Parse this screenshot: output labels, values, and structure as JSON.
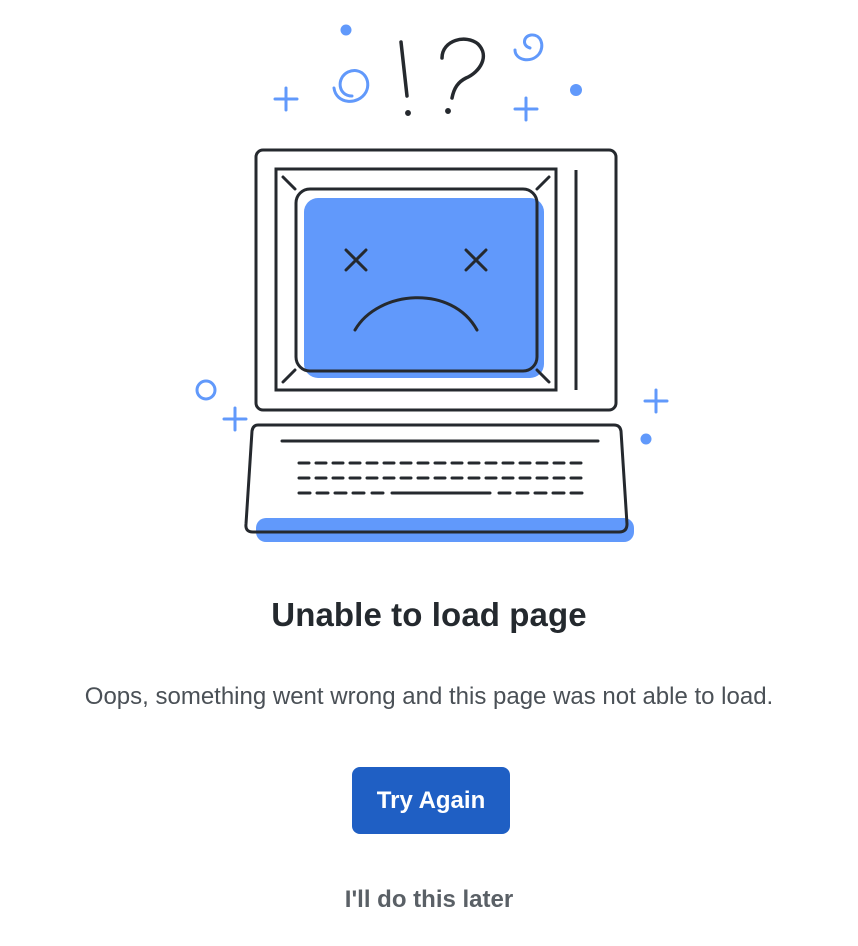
{
  "error": {
    "title": "Unable to load page",
    "message": "Oops, something went wrong and this page was not able to load.",
    "retry_label": "Try Again",
    "later_label": "I'll do this later"
  },
  "illustration": {
    "icon": "broken-computer-icon",
    "colors": {
      "accent": "#6199fb",
      "line": "#25292e",
      "button": "#1f5fc4"
    }
  }
}
